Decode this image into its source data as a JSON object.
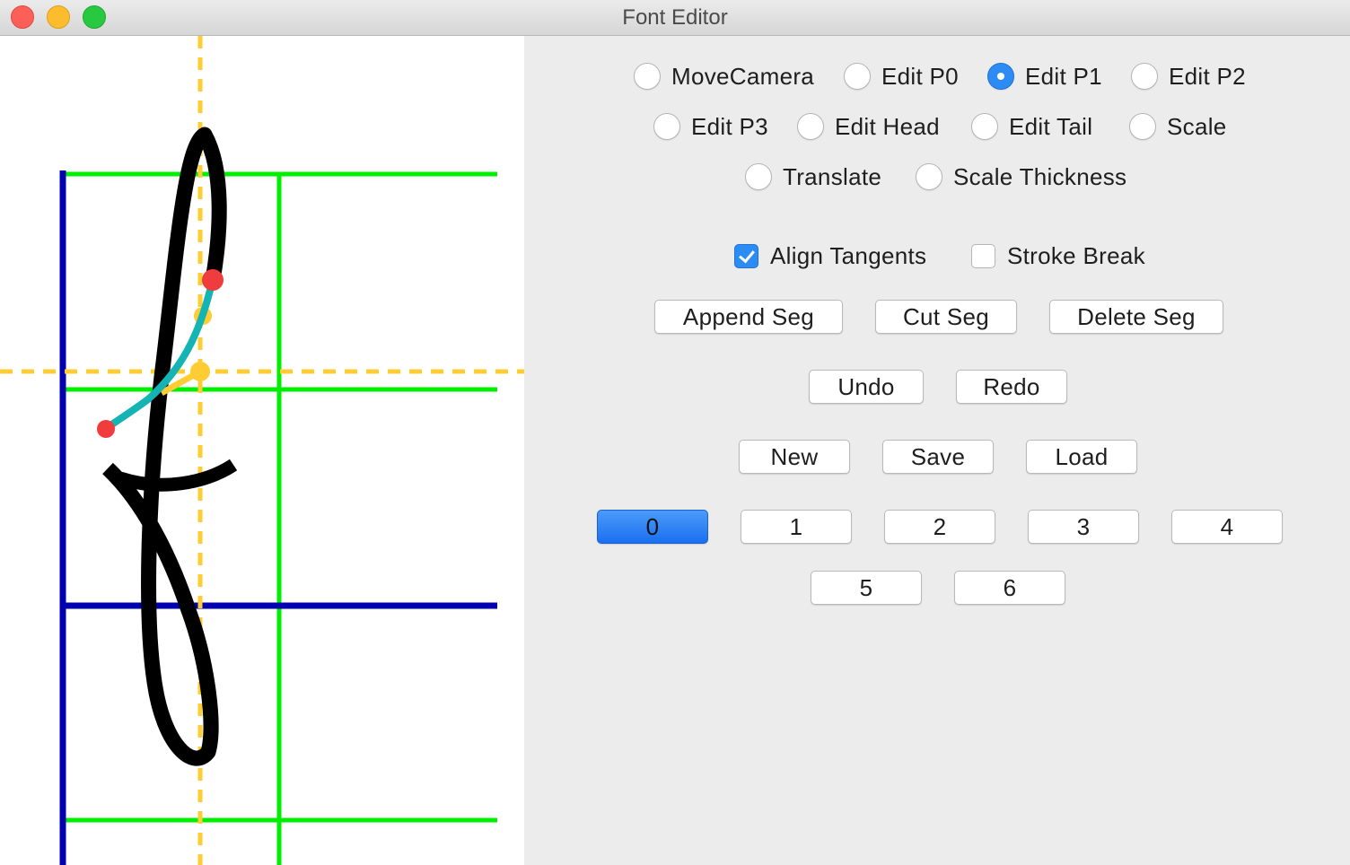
{
  "window": {
    "title": "Font Editor"
  },
  "modes": [
    {
      "label": "MoveCamera",
      "selected": false
    },
    {
      "label": "Edit P0",
      "selected": false
    },
    {
      "label": "Edit P1",
      "selected": true
    },
    {
      "label": "Edit P2",
      "selected": false
    },
    {
      "label": "Edit P3",
      "selected": false
    },
    {
      "label": "Edit Head",
      "selected": false
    },
    {
      "label": "Edit Tail",
      "selected": false
    },
    {
      "label": "Scale",
      "selected": false
    },
    {
      "label": "Translate",
      "selected": false
    },
    {
      "label": "Scale Thickness",
      "selected": false
    }
  ],
  "options": {
    "align_tangents": {
      "label": "Align Tangents",
      "checked": true
    },
    "stroke_break": {
      "label": "Stroke Break",
      "checked": false
    }
  },
  "segment_buttons": {
    "append": "Append Seg",
    "cut": "Cut Seg",
    "delete": "Delete Seg"
  },
  "history_buttons": {
    "undo": "Undo",
    "redo": "Redo"
  },
  "file_buttons": {
    "new": "New",
    "save": "Save",
    "load": "Load"
  },
  "glyph_slots": {
    "labels": [
      "0",
      "1",
      "2",
      "3",
      "4",
      "5",
      "6"
    ],
    "selected": "0"
  },
  "colors": {
    "guide_green": "#00ee00",
    "guide_blue": "#0000b0",
    "guide_dashed": "#ffcc33",
    "stroke": "#000000",
    "active_segment": "#14b4b4",
    "endpoint": "#f03c3c",
    "control_point": "#ffcc33",
    "accent": "#2c8cf4"
  }
}
